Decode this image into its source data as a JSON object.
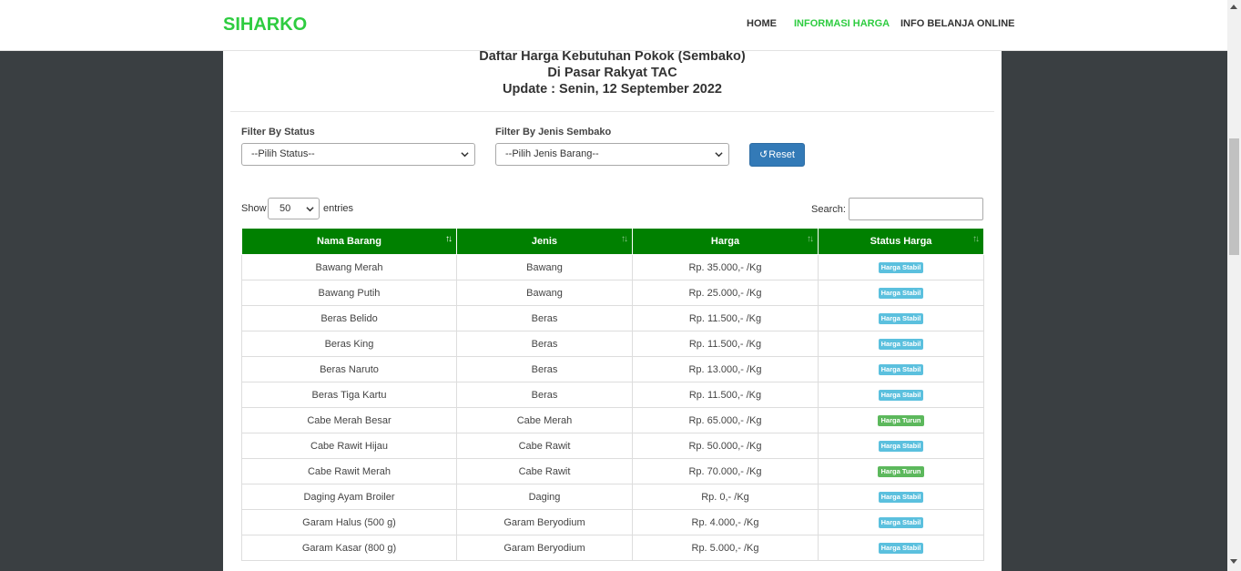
{
  "navbar": {
    "brand": "SIHARKO",
    "links": [
      "HOME",
      "INFORMASI HARGA",
      "INFO BELANJA ONLINE"
    ],
    "active_link": "INFORMASI HARGA"
  },
  "header": {
    "title_line1": "Daftar Harga Kebutuhan Pokok (Sembako)",
    "title_line2": "Di Pasar Rakyat TAC",
    "title_line3": "Update : Senin, 12 September 2022"
  },
  "filters": {
    "status_label": "Filter By Status",
    "status_value": "--Pilih Status--",
    "jenis_label": "Filter By Jenis Sembako",
    "jenis_value": "--Pilih Jenis Barang--",
    "reset_icon": "refresh-icon",
    "reset_label": "Reset"
  },
  "table_controls": {
    "show_label": "Show",
    "entries_value": "50",
    "entries_label": "entries",
    "search_label": "Search:",
    "search_value": ""
  },
  "table": {
    "columns": [
      "Nama Barang",
      "Jenis",
      "Harga",
      "Status Harga"
    ],
    "sorted_column": "Nama Barang",
    "rows": [
      {
        "nama": "Bawang Merah",
        "jenis": "Bawang",
        "harga": "Rp. 35.000,- /Kg",
        "status": "Harga Stabil"
      },
      {
        "nama": "Bawang Putih",
        "jenis": "Bawang",
        "harga": "Rp. 25.000,- /Kg",
        "status": "Harga Stabil"
      },
      {
        "nama": "Beras Belido",
        "jenis": "Beras",
        "harga": "Rp. 11.500,- /Kg",
        "status": "Harga Stabil"
      },
      {
        "nama": "Beras King",
        "jenis": "Beras",
        "harga": "Rp. 11.500,- /Kg",
        "status": "Harga Stabil"
      },
      {
        "nama": "Beras Naruto",
        "jenis": "Beras",
        "harga": "Rp. 13.000,- /Kg",
        "status": "Harga Stabil"
      },
      {
        "nama": "Beras Tiga Kartu",
        "jenis": "Beras",
        "harga": "Rp. 11.500,- /Kg",
        "status": "Harga Stabil"
      },
      {
        "nama": "Cabe Merah Besar",
        "jenis": "Cabe Merah",
        "harga": "Rp. 65.000,- /Kg",
        "status": "Harga Turun"
      },
      {
        "nama": "Cabe Rawit Hijau",
        "jenis": "Cabe Rawit",
        "harga": "Rp. 50.000,- /Kg",
        "status": "Harga Stabil"
      },
      {
        "nama": "Cabe Rawit Merah",
        "jenis": "Cabe Rawit",
        "harga": "Rp. 70.000,- /Kg",
        "status": "Harga Turun"
      },
      {
        "nama": "Daging Ayam Broiler",
        "jenis": "Daging",
        "harga": "Rp. 0,- /Kg",
        "status": "Harga Stabil"
      },
      {
        "nama": "Garam Halus (500 g)",
        "jenis": "Garam Beryodium",
        "harga": "Rp. 4.000,- /Kg",
        "status": "Harga Stabil"
      },
      {
        "nama": "Garam Kasar (800 g)",
        "jenis": "Garam Beryodium",
        "harga": "Rp. 5.000,- /Kg",
        "status": "Harga Stabil"
      }
    ]
  },
  "colors": {
    "brand": "#2ecc40",
    "header_bg": "#008000",
    "badge_stabil": "#5bc0de",
    "badge_turun": "#5cb85c",
    "reset_button": "#337ab7"
  }
}
